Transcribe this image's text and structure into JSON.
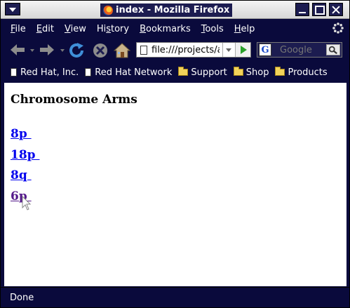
{
  "window": {
    "title": "index - Mozilla Firefox"
  },
  "menu": {
    "items": [
      {
        "accel": "F",
        "rest": "ile"
      },
      {
        "accel": "E",
        "rest": "dit"
      },
      {
        "accel": "V",
        "rest": "iew"
      },
      {
        "pre": "Hi",
        "accel": "s",
        "rest": "tory"
      },
      {
        "accel": "B",
        "rest": "ookmarks"
      },
      {
        "accel": "T",
        "rest": "ools"
      },
      {
        "accel": "H",
        "rest": "elp"
      }
    ]
  },
  "navbar": {
    "url": "file:///projects/a",
    "search_placeholder": "Google"
  },
  "bookmarks": [
    {
      "label": "Red Hat, Inc.",
      "icon": "page"
    },
    {
      "label": "Red Hat Network",
      "icon": "page"
    },
    {
      "label": "Support",
      "icon": "folder"
    },
    {
      "label": "Shop",
      "icon": "folder"
    },
    {
      "label": "Products",
      "icon": "folder"
    }
  ],
  "page": {
    "heading": "Chromosome Arms",
    "links": [
      {
        "label": "8p ",
        "visited": false
      },
      {
        "label": "18p ",
        "visited": false
      },
      {
        "label": "8q ",
        "visited": false
      },
      {
        "label": "6p ",
        "visited": true
      }
    ]
  },
  "status": {
    "text": "Done"
  }
}
